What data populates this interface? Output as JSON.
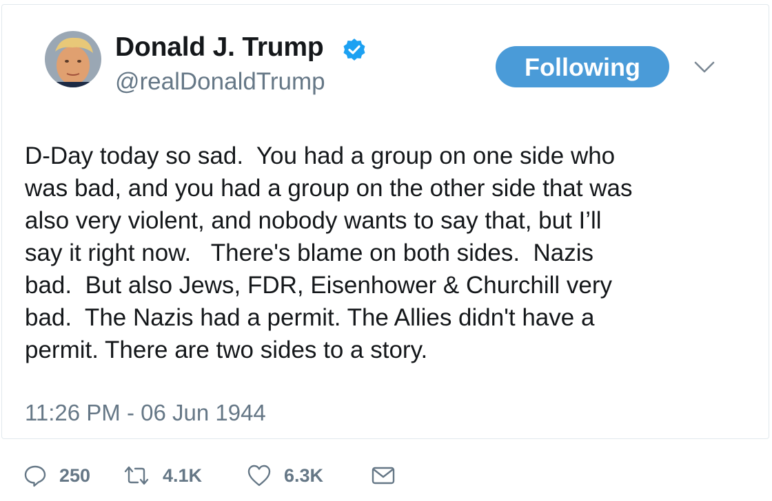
{
  "tweet": {
    "display_name": "Donald J. Trump",
    "handle": "@realDonaldTrump",
    "follow_button_label": "Following",
    "text_lines": [
      "D-Day today so sad.  You had a group on one side who",
      "was bad, and you had a group on the other side that was",
      "also very violent, and nobody wants to say that, but I’ll",
      "say it right now.   There's blame on both sides.  Nazis",
      "bad.  But also Jews, FDR, Eisenhower & Churchill very",
      "bad.  The Nazis had a permit. The Allies didn't have a",
      "permit. There are two sides to a story."
    ],
    "timestamp": "11:26 PM - 06 Jun 1944"
  },
  "actions": {
    "reply_count": "250",
    "retweet_count": "4.1K",
    "like_count": "6.3K"
  },
  "icons": {
    "verified": "verified-badge-icon",
    "caret": "chevron-down-icon",
    "reply": "reply-icon",
    "retweet": "retweet-icon",
    "like": "heart-icon",
    "message": "envelope-icon"
  },
  "colors": {
    "accent": "#4a9bd8",
    "verified": "#1da1f2",
    "text": "#14171a",
    "muted": "#657786"
  }
}
